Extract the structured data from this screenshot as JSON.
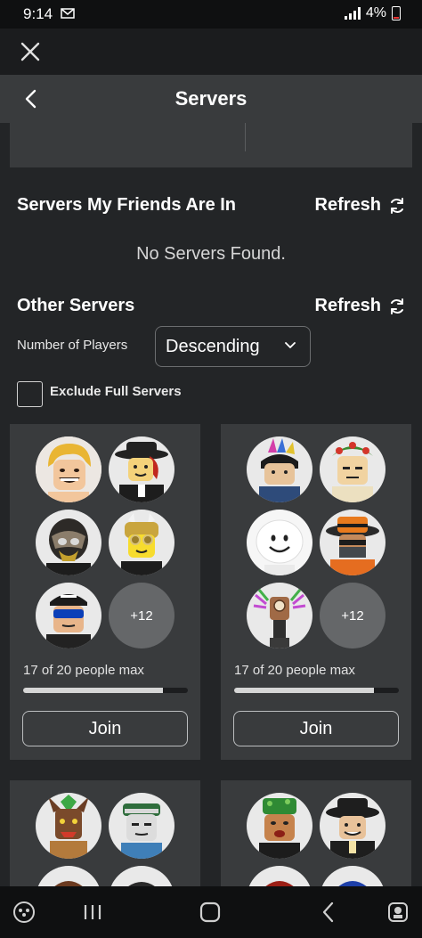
{
  "status_bar": {
    "time": "9:14",
    "battery": "4%"
  },
  "header": {
    "title": "Servers"
  },
  "friends_section": {
    "title": "Servers My Friends Are In",
    "refresh_label": "Refresh",
    "empty_text": "No Servers Found."
  },
  "other_section": {
    "title": "Other Servers",
    "refresh_label": "Refresh",
    "sort_label": "Number of Players",
    "sort_value": "Descending",
    "exclude_label": "Exclude Full Servers",
    "exclude_checked": false
  },
  "servers": [
    {
      "more_count": "+12",
      "player_text": "17 of 20 people max",
      "players": 17,
      "max_players": 20,
      "join_label": "Join",
      "avatars": [
        "blonde-smiling-avatar",
        "red-hair-fedora-avatar",
        "gold-mask-avatar",
        "gold-helmet-avatar",
        "sunglasses-cap-avatar"
      ]
    },
    {
      "more_count": "+12",
      "player_text": "17 of 20 people max",
      "players": 17,
      "max_players": 20,
      "join_label": "Join",
      "avatars": [
        "party-hat-avatar",
        "leaf-crown-avatar",
        "white-smile-avatar",
        "orange-hat-avatar",
        "antler-avatar"
      ]
    },
    {
      "avatars": [
        "horned-mask-avatar",
        "sunglasses-smile-avatar",
        "partial-avatar",
        "partial-avatar"
      ]
    },
    {
      "avatars": [
        "green-hat-avatar",
        "fedora-avatar",
        "red-hair-avatar",
        "blue-hair-avatar"
      ]
    }
  ]
}
